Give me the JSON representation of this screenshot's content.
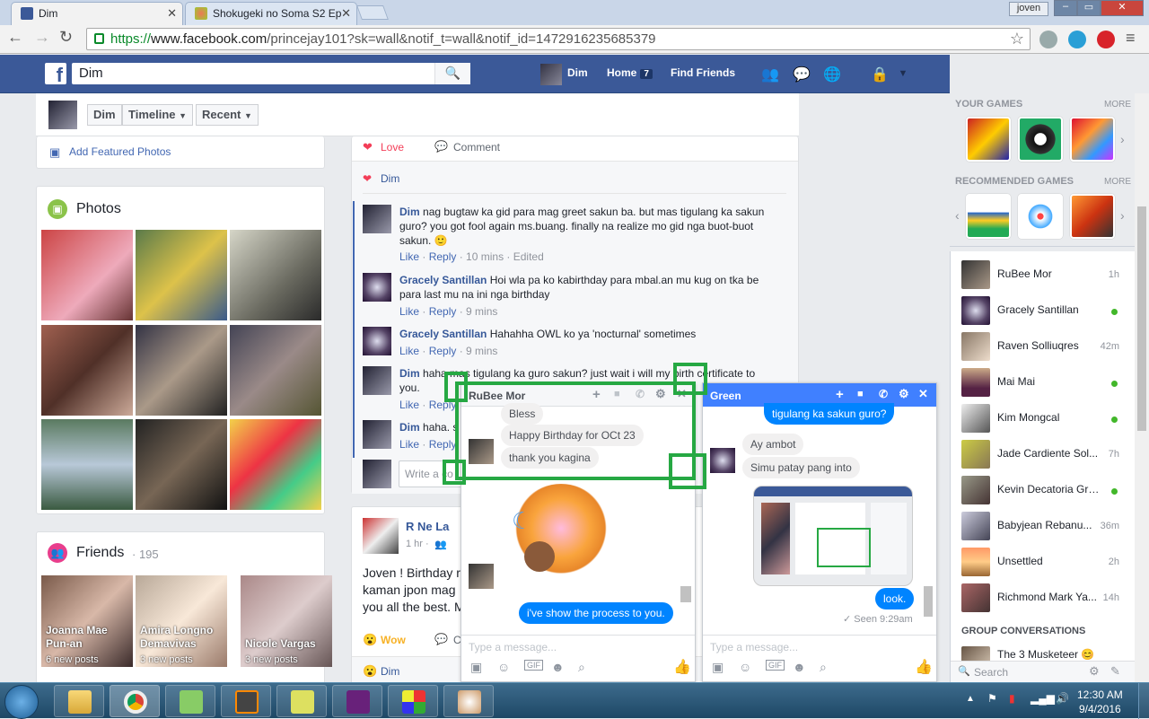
{
  "browser": {
    "tabs": [
      {
        "title": "Dim"
      },
      {
        "title": "Shokugeki no Soma S2 Ep"
      }
    ],
    "user_label": "joven",
    "url": {
      "scheme": "https://",
      "domain": "www.facebook.com",
      "path": "/princejay101?sk=wall&notif_t=wall&notif_id=1472916235685379"
    }
  },
  "fb": {
    "search_value": "Dim",
    "nav": {
      "profile_name": "Dim",
      "home": "Home",
      "home_count": "7",
      "find_friends": "Find Friends"
    }
  },
  "profile": {
    "buttons": {
      "name": "Dim",
      "timeline": "Timeline",
      "recent": "Recent"
    },
    "add_featured": "Add Featured Photos",
    "photos_title": "Photos",
    "friends_title": "Friends",
    "friends_count": "· 195",
    "friends": [
      {
        "name": "Joanna Mae Pun-an",
        "posts": "6 new posts"
      },
      {
        "name": "Amira Longno Demavivas",
        "posts": "3 new posts"
      },
      {
        "name": "Nicole Vargas",
        "posts": "3 new posts"
      }
    ]
  },
  "post": {
    "love": "Love",
    "comment": "Comment",
    "reactor": "Dim",
    "comments": [
      {
        "name": "Dim",
        "text": "nag bugtaw ka gid para mag greet sakun ba. but mas tigulang ka sakun guro? you got fool again ms.buang. finally na realize mo gid nga buot-buot sakun. 🙂",
        "like": "Like",
        "reply": "Reply",
        "time": "· 10 mins · Edited"
      },
      {
        "name": "Gracely Santillan",
        "text": "Hoi wla pa ko kabirthday para mbal.an mu kug on tka be para last mu na ini nga birthday",
        "like": "Like",
        "reply": "Reply",
        "time": "· 9 mins"
      },
      {
        "name": "Gracely Santillan",
        "text": "Hahahha OWL ko ya 'nocturnal' sometimes",
        "like": "Like",
        "reply": "Reply",
        "time": "· 9 mins"
      },
      {
        "name": "Dim",
        "text": "haha mas tigulang ka guro sakun? just wait i will my birth certificate to you.",
        "like": "Like",
        "reply": "Reply",
        "time": ""
      },
      {
        "name": "Dim",
        "text": "haha. s",
        "like": "Like",
        "reply": "Reply",
        "time": ""
      }
    ],
    "write_placeholder": "Write a co"
  },
  "post2": {
    "author": "R Ne La",
    "time": "1 hr ·",
    "text": "Joven ! Birthday r kaman jpon mag you all the best. M",
    "wow": "Wow",
    "comment_short": "Co",
    "reactor": "Dim"
  },
  "sidebar": {
    "your_games": "YOUR GAMES",
    "recommended_games": "RECOMMENDED GAMES",
    "more": "MORE",
    "group_conversations": "GROUP CONVERSATIONS",
    "group_first": "The 3 Musketeer 😊",
    "search_placeholder": "Search",
    "contacts": [
      {
        "name": "RuBee Mor",
        "status": "1h",
        "online": false
      },
      {
        "name": "Gracely Santillan",
        "status": "",
        "online": true
      },
      {
        "name": "Raven Solliuqres",
        "status": "42m",
        "online": false
      },
      {
        "name": "Mai Mai",
        "status": "",
        "online": true
      },
      {
        "name": "Kim Mongcal",
        "status": "",
        "online": true
      },
      {
        "name": "Jade Cardiente Sol...",
        "status": "7h",
        "online": false
      },
      {
        "name": "Kevin Decatoria Grajo",
        "status": "",
        "online": true
      },
      {
        "name": "Babyjean Rebanu...",
        "status": "36m",
        "online": false
      },
      {
        "name": "Unsettled",
        "status": "2h",
        "online": false
      },
      {
        "name": "Richmond Mark Ya...",
        "status": "14h",
        "online": false
      }
    ]
  },
  "chat1": {
    "name": "RuBee Mor",
    "messages": [
      "Bless",
      "Happy Birthday for OCt 23",
      "thank you kagina"
    ],
    "sent": "i've show the process to you.",
    "placeholder": "Type a message..."
  },
  "chat2": {
    "name": "Green",
    "sent_top": "tigulang ka sakun guro?",
    "messages": [
      "Ay ambot",
      "Simu patay pang into"
    ],
    "sent": "look.",
    "seen": "✓ Seen 9:29am",
    "placeholder": "Type a message..."
  },
  "taskbar": {
    "time": "12:30 AM",
    "date": "9/4/2016"
  },
  "icons": {
    "brand": "#3b5998",
    "messenger_blue": "#0084ff",
    "online_green": "#42b72a",
    "highlight_green": "#26a843"
  }
}
